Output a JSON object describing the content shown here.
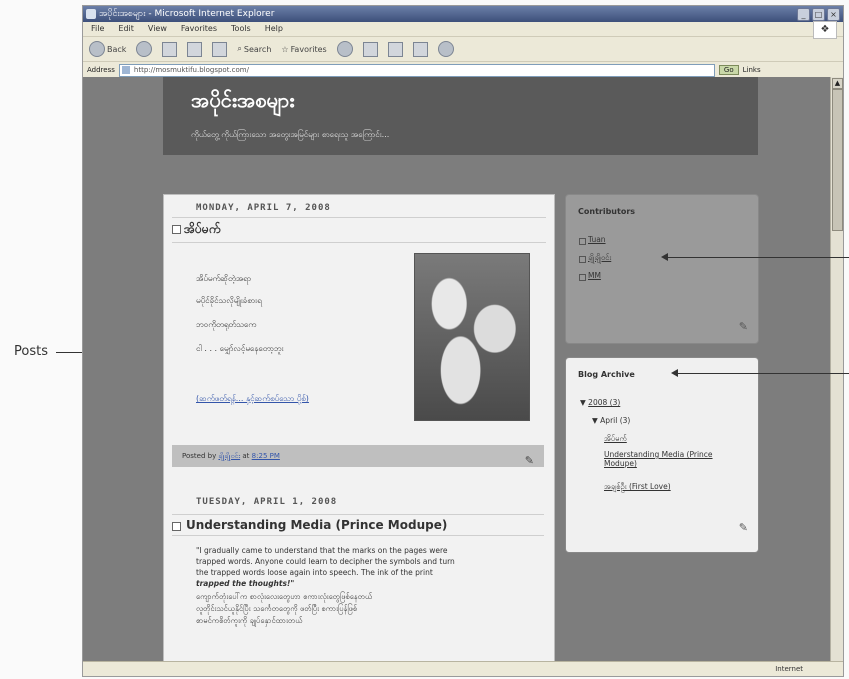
{
  "callouts": {
    "posts": "Posts"
  },
  "window": {
    "title": "အပိုင်းအစများ - Microsoft Internet Explorer",
    "menu": [
      "File",
      "Edit",
      "View",
      "Favorites",
      "Tools",
      "Help"
    ],
    "toolbar": {
      "back": "Back",
      "search": "Search",
      "favorites": "Favorites"
    },
    "address_label": "Address",
    "address_value": "http://mosmuktifu.blogspot.com/",
    "go": "Go",
    "links": "Links"
  },
  "blog": {
    "title": "အပိုင်းအစများ",
    "description": "ကိုယ်တွေ့ ကိုယ်ကြားသော အတွေးအမြင်များ စာရေးသူ အကြောင်း..."
  },
  "posts": [
    {
      "date": "MONDAY, APRIL 7, 2008",
      "title": "အိပ်မက်",
      "lines": [
        "အိပ်မက်ဆိုတဲ့အရာ",
        "မပိုင်ခိုင်သလိုမျိုးခံစားရ",
        "ဘဝကိုတရုတ်သကေ",
        "ငါ . . . မျှော်လင့်မနေတော့ဘူး"
      ],
      "read_more": "(ဆက်ဖတ်ရန်... နှင့်ဆက်စပ်သော ပို့စ်)",
      "footer_prefix": "Posted by",
      "author": "ချိုချိုဝင်း",
      "at": "at",
      "time": "8:25 PM"
    },
    {
      "date": "TUESDAY, APRIL 1, 2008",
      "title": "Understanding Media (Prince Modupe)",
      "lines": [
        "\"I gradually came to understand that the marks on the pages were",
        "trapped words. Anyone could learn to decipher the symbols and turn",
        "the trapped words loose again into speech. The ink of the print",
        "trapped the thoughts!\"",
        "ကျောက်တုံးပေါ်က စာလုံးလေးတွေဟာ စကားလုံးတွေဖြစ်နေတယ်",
        "လူတိုင်းသင်ယူနိုင်ပြီး သင်္ကေတတွေကို ဖတ်ပြီး စကားပြန်ဖြစ်",
        "စာမင်ကစိတ်ကူးကို ချုပ်နှောင်ထားတယ်"
      ]
    }
  ],
  "contributors": {
    "title": "Contributors",
    "items": [
      "Tuan",
      "ချိုချိုဝင်း",
      "MM"
    ]
  },
  "archive": {
    "title": "Blog Archive",
    "year": "2008 (3)",
    "month": "April (3)",
    "posts": [
      "အိပ်မက်",
      "Understanding Media (Prince Modupe)",
      "အချစ်ဦး (First Love)"
    ]
  },
  "status": {
    "zone": "Internet"
  }
}
